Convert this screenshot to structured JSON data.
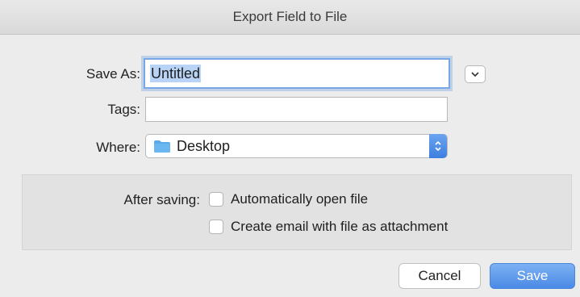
{
  "dialog": {
    "title": "Export Field to File"
  },
  "form": {
    "save_as_label": "Save As:",
    "save_as_value": "Untitled",
    "tags_label": "Tags:",
    "tags_value": "",
    "where_label": "Where:",
    "where_value": "Desktop",
    "expand_icon": "chevron-down-icon",
    "folder_icon": "folder-icon",
    "stepper_icon": "up-down-chevron-icon"
  },
  "options": {
    "after_saving_label": "After saving:",
    "items": [
      {
        "label": "Automatically open file",
        "checked": false
      },
      {
        "label": "Create email with file as attachment",
        "checked": false
      }
    ]
  },
  "buttons": {
    "cancel_label": "Cancel",
    "save_label": "Save"
  },
  "colors": {
    "accent": "#4a8ae6",
    "selection": "#b8d3f5",
    "folder": "#5aa9e8"
  }
}
